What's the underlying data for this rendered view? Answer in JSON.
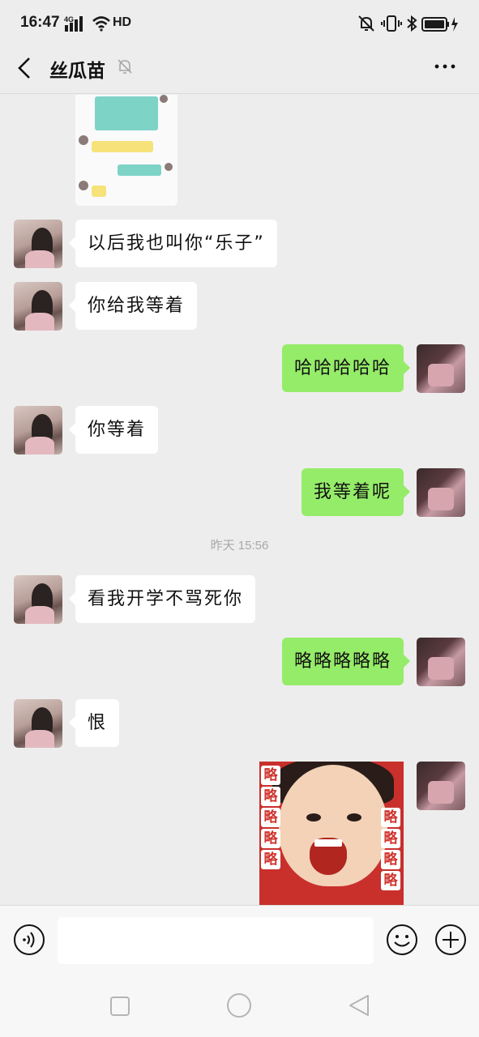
{
  "status_bar": {
    "time": "16:47",
    "network_label": "4G",
    "hd_label": "HD",
    "icons": [
      "signal-icon",
      "wifi-icon",
      "mute-icon",
      "vibrate-icon",
      "bluetooth-icon",
      "battery-icon",
      "charging-icon"
    ]
  },
  "header": {
    "back_icon": "chevron-left-icon",
    "title": "丝瓜苗",
    "mute_icon": "bell-off-icon",
    "more_icon": "more-dots-icon"
  },
  "colors": {
    "background": "#ededed",
    "incoming_bubble": "#ffffff",
    "outgoing_bubble": "#95ec69",
    "timestamp": "#a8a8a8"
  },
  "messages": [
    {
      "side": "in",
      "type": "image",
      "description_icon": "screenshot-image"
    },
    {
      "side": "in",
      "type": "text",
      "text": "以后我也叫你“乐子”"
    },
    {
      "side": "in",
      "type": "text",
      "text": "你给我等着"
    },
    {
      "side": "out",
      "type": "text",
      "text": "哈哈哈哈哈"
    },
    {
      "side": "in",
      "type": "text",
      "text": "你等着"
    },
    {
      "side": "out",
      "type": "text",
      "text": "我等着呢"
    },
    {
      "type": "timestamp",
      "text": "昨天 15:56"
    },
    {
      "side": "in",
      "type": "text",
      "text": "看我开学不骂死你"
    },
    {
      "side": "out",
      "type": "text",
      "text": "略略略略略"
    },
    {
      "side": "in",
      "type": "text",
      "text": "恨"
    },
    {
      "side": "out",
      "type": "sticker",
      "sticker_text": "略"
    }
  ],
  "input_bar": {
    "value": "",
    "voice_icon": "voice-icon",
    "emoji_icon": "emoji-icon",
    "plus_icon": "plus-icon"
  },
  "system_nav": {
    "icons": [
      "recent-apps-icon",
      "home-icon",
      "back-triangle-icon"
    ]
  }
}
